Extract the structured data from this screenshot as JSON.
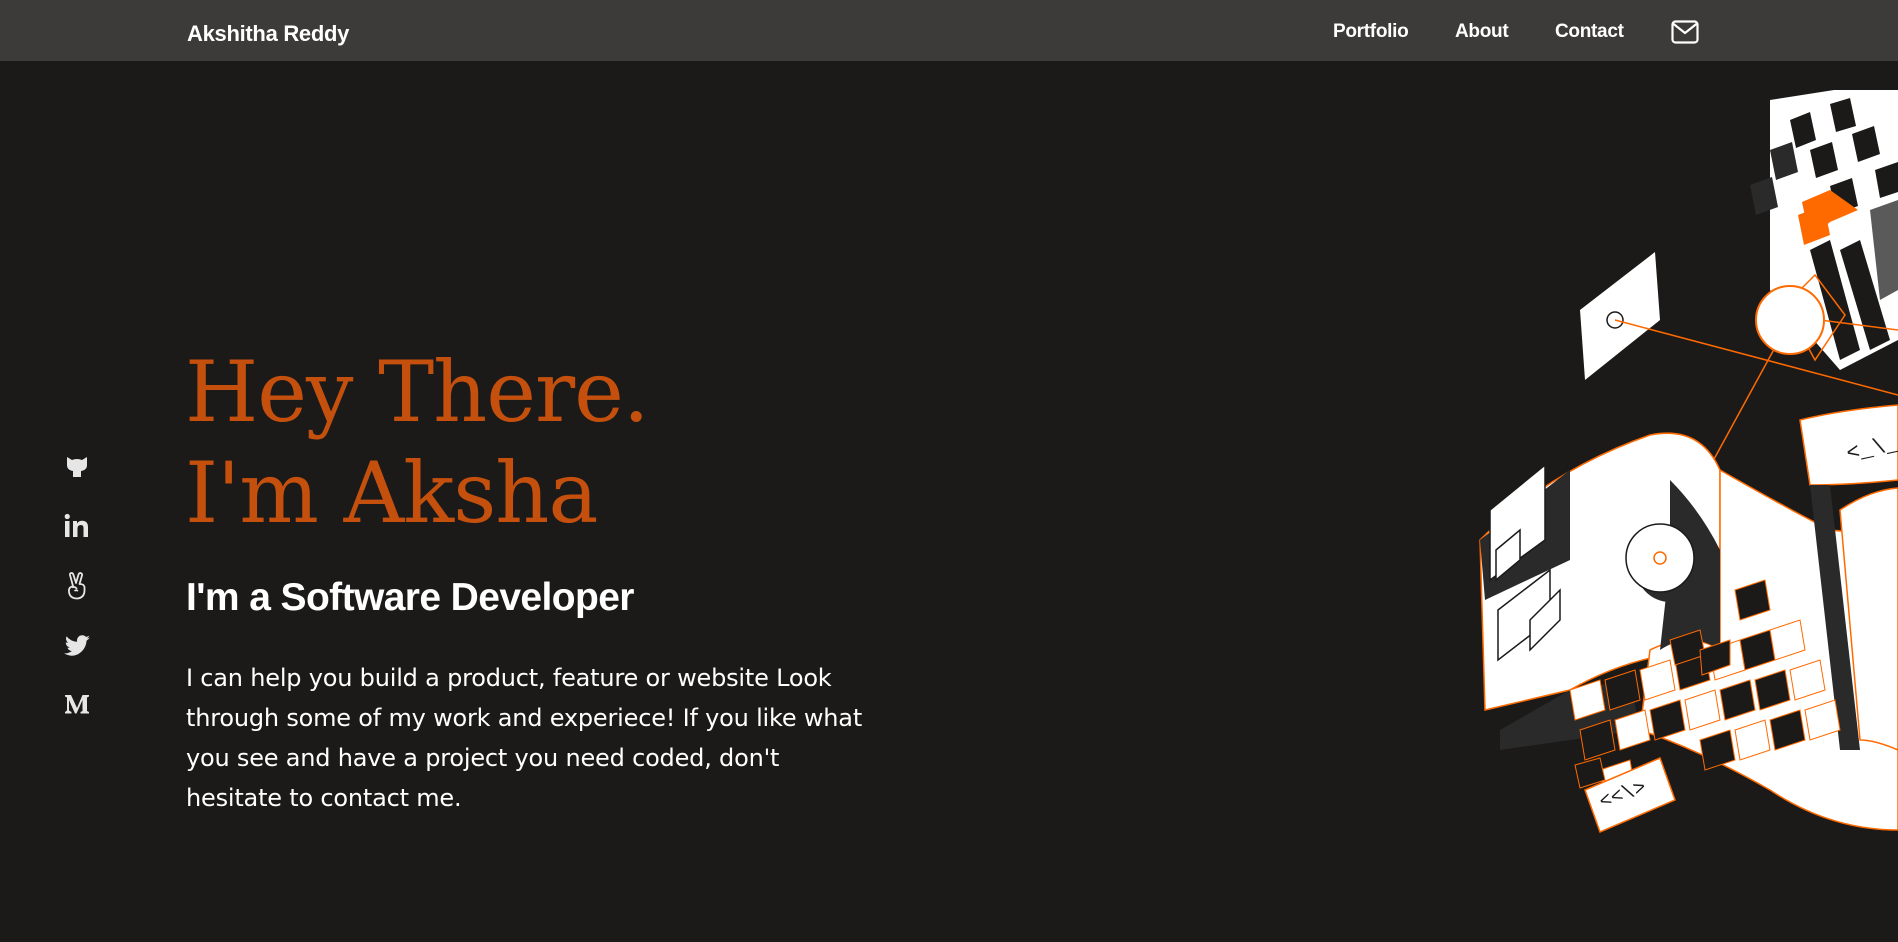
{
  "nav": {
    "brand": "Akshitha Reddy",
    "links": [
      {
        "label": "Portfolio"
      },
      {
        "label": "About"
      },
      {
        "label": "Contact"
      }
    ],
    "mail_icon": "mail-icon"
  },
  "social": [
    {
      "name": "github",
      "icon": "github-icon"
    },
    {
      "name": "linkedin",
      "icon": "linkedin-icon"
    },
    {
      "name": "angellist",
      "icon": "angellist-icon"
    },
    {
      "name": "twitter",
      "icon": "twitter-icon"
    },
    {
      "name": "medium",
      "icon": "medium-icon"
    }
  ],
  "hero": {
    "greeting_line1": "Hey There.",
    "greeting_line2": "I'm Aksha",
    "role": "I'm a Software Developer",
    "intro": "I can help you build a product, feature or website Look through some of my work and experiece! If you like what you see and have a project you need coded, don't hesitate to contact me.",
    "art_code_tag_1": "<_\\_",
    "art_code_tag_2": "<<\\>"
  },
  "colors": {
    "background": "#1b1a19",
    "navbar": "#3c3b3a",
    "accent": "#c5500e",
    "text": "#ffffff",
    "art_orange": "#ff6a00"
  }
}
